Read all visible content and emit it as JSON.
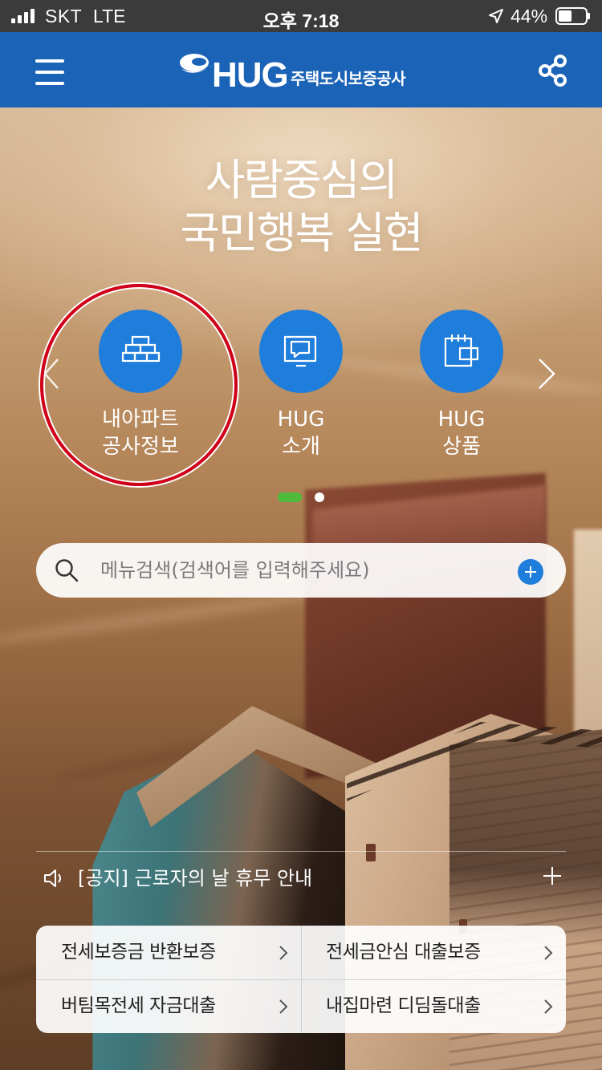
{
  "status_bar": {
    "carrier": "SKT",
    "network": "LTE",
    "time": "오후 7:18",
    "battery_percent": "44%"
  },
  "header": {
    "brand": "HUG",
    "brand_subtitle": "주택도시보증공사",
    "icons": [
      "hamburger-menu-icon",
      "share-icon"
    ]
  },
  "hero": {
    "title_line1": "사람중심의",
    "title_line2": "국민행복 실현"
  },
  "quick_menu": {
    "items": [
      {
        "label": "내아파트\n공사정보",
        "icon": "apartment-blocks-icon",
        "highlighted": true
      },
      {
        "label": "HUG\n소개",
        "icon": "presentation-icon"
      },
      {
        "label": "HUG\n상품",
        "icon": "calendar-card-icon"
      }
    ],
    "page": 1,
    "page_count": 2
  },
  "search": {
    "placeholder": "메뉴검색(검색어를 입력해주세요)"
  },
  "notice": {
    "text": "[공지] 근로자의 날 휴무 안내"
  },
  "shortcuts": [
    {
      "label": "전세보증금 반환보증"
    },
    {
      "label": "전세금안심 대출보증"
    },
    {
      "label": "버팀목전세 자금대출"
    },
    {
      "label": "내집마련 디딤돌대출"
    }
  ],
  "colors": {
    "header_blue": "#1b63b6",
    "icon_circle_blue": "#1f7ddb",
    "pager_active_green": "#4fbb3c",
    "highlight_red": "#d1001a"
  }
}
